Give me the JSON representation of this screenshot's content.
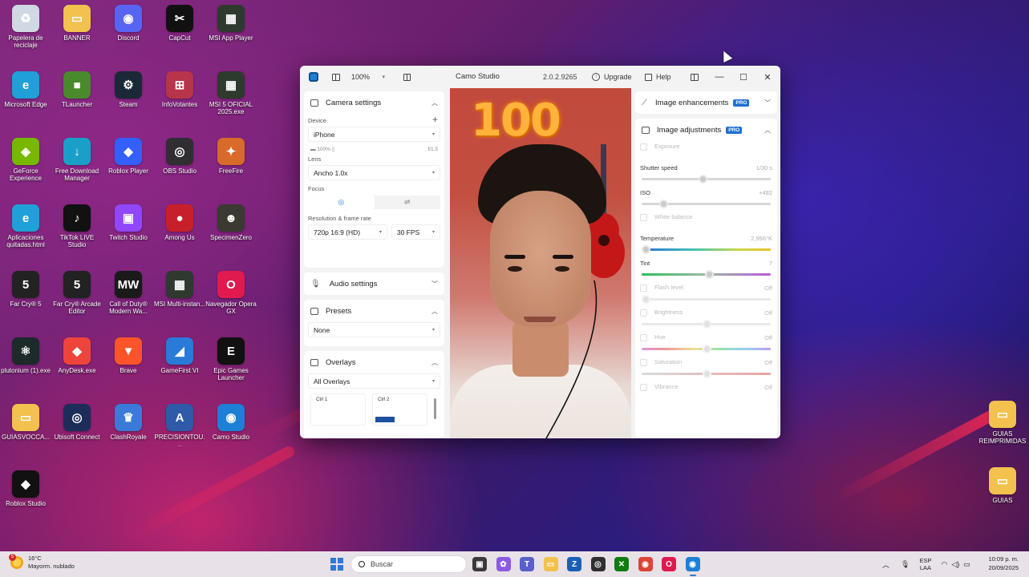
{
  "desktop": {
    "icons": [
      {
        "label": "Papelera de reciclaje",
        "icon": "recycle-bin-icon",
        "color": "#cfd8e3",
        "glyph": "♻"
      },
      {
        "label": "BANNER",
        "icon": "folder-icon",
        "color": "#f2c14e",
        "glyph": "▭"
      },
      {
        "label": "Discord",
        "icon": "discord-icon",
        "color": "#5865f2",
        "glyph": "◉"
      },
      {
        "label": "CapCut",
        "icon": "capcut-icon",
        "color": "#111111",
        "glyph": "✂"
      },
      {
        "label": "MSI App Player",
        "icon": "msi-app-player-icon",
        "color": "#2e3a2e",
        "glyph": "▦"
      },
      {
        "label": "Microsoft Edge",
        "icon": "edge-icon",
        "color": "#1fa0d8",
        "glyph": "e"
      },
      {
        "label": "TLauncher",
        "icon": "tlauncher-icon",
        "color": "#4b8a2c",
        "glyph": "■"
      },
      {
        "label": "Steam",
        "icon": "steam-icon",
        "color": "#1b2838",
        "glyph": "⚙"
      },
      {
        "label": "InfoVotantes",
        "icon": "infovotantes-icon",
        "color": "#b8344a",
        "glyph": "⊞"
      },
      {
        "label": "MSI 5 OFICIAL 2025.exe",
        "icon": "msi-exe-icon",
        "color": "#2e3a2e",
        "glyph": "▦"
      },
      {
        "label": "GeForce Experience",
        "icon": "geforce-icon",
        "color": "#76b900",
        "glyph": "◈"
      },
      {
        "label": "Free Download Manager",
        "icon": "fdm-icon",
        "color": "#1aa0c8",
        "glyph": "↓"
      },
      {
        "label": "Roblox Player",
        "icon": "roblox-player-icon",
        "color": "#335fff",
        "glyph": "◆"
      },
      {
        "label": "OBS Studio",
        "icon": "obs-icon",
        "color": "#302e31",
        "glyph": "◎"
      },
      {
        "label": "FreeFire",
        "icon": "freefire-icon",
        "color": "#d86a2a",
        "glyph": "✦"
      },
      {
        "label": "Aplicaciones quitadas.html",
        "icon": "edge-html-icon",
        "color": "#1fa0d8",
        "glyph": "e"
      },
      {
        "label": "TikTok LIVE Studio",
        "icon": "tiktok-icon",
        "color": "#111111",
        "glyph": "♪"
      },
      {
        "label": "Twitch Studio",
        "icon": "twitch-icon",
        "color": "#9146ff",
        "glyph": "▣"
      },
      {
        "label": "Among Us",
        "icon": "among-us-icon",
        "color": "#c8202a",
        "glyph": "●"
      },
      {
        "label": "SpecimenZero",
        "icon": "specimenzero-icon",
        "color": "#3a3a30",
        "glyph": "☻"
      },
      {
        "label": "Far Cry® 5",
        "icon": "farcry5-icon",
        "color": "#222222",
        "glyph": "5"
      },
      {
        "label": "Far Cry® Arcade Editor",
        "icon": "farcry-arcade-icon",
        "color": "#222222",
        "glyph": "5"
      },
      {
        "label": "Call of Duty® Modern Wa...",
        "icon": "cod-icon",
        "color": "#1a1a1a",
        "glyph": "MW"
      },
      {
        "label": "MSI Multi-instan...",
        "icon": "msi-multi-icon",
        "color": "#2e3a2e",
        "glyph": "▦"
      },
      {
        "label": "Navegador Opera GX",
        "icon": "opera-gx-icon",
        "color": "#e01a4f",
        "glyph": "O"
      },
      {
        "label": "plutonium (1).exe",
        "icon": "plutonium-icon",
        "color": "#1c2a2a",
        "glyph": "⚛"
      },
      {
        "label": "AnyDesk.exe",
        "icon": "anydesk-icon",
        "color": "#ef443b",
        "glyph": "◆"
      },
      {
        "label": "Brave",
        "icon": "brave-icon",
        "color": "#fb542b",
        "glyph": "▼"
      },
      {
        "label": "GameFirst VI",
        "icon": "gamefirst-icon",
        "color": "#2a7ad8",
        "glyph": "◢"
      },
      {
        "label": "Epic Games Launcher",
        "icon": "epic-icon",
        "color": "#111111",
        "glyph": "E"
      },
      {
        "label": "GUIASVOCCA...",
        "icon": "folder-icon",
        "color": "#f2c14e",
        "glyph": "▭"
      },
      {
        "label": "Ubisoft Connect",
        "icon": "ubisoft-icon",
        "color": "#1c2d5a",
        "glyph": "◎"
      },
      {
        "label": "ClashRoyale",
        "icon": "clash-royale-icon",
        "color": "#3a7ad8",
        "glyph": "♛"
      },
      {
        "label": "PRECISIONTOU...",
        "icon": "asus-icon",
        "color": "#2e5aa8",
        "glyph": "A"
      },
      {
        "label": "Camo Studio",
        "icon": "camo-icon",
        "color": "#1d7fd6",
        "glyph": "◉"
      },
      {
        "label": "Roblox Studio",
        "icon": "roblox-studio-icon",
        "color": "#111111",
        "glyph": "◆"
      }
    ],
    "right_icons": [
      {
        "label": "GUIAS REIMPRIMIDAS",
        "icon": "folder-icon",
        "color": "#f2c14e",
        "glyph": "▭"
      },
      {
        "label": "GUIAS",
        "icon": "folder-icon",
        "color": "#f2c14e",
        "glyph": "▭"
      }
    ]
  },
  "window": {
    "zoom": "100%",
    "title": "Camo Studio",
    "version": "2.0.2.9265",
    "upgrade_label": "Upgrade",
    "help_label": "Help",
    "minimize": "—",
    "maximize": "☐",
    "close": "✕"
  },
  "left": {
    "camera_settings": {
      "title": "Camera settings",
      "device_label": "Device",
      "device_value": "iPhone",
      "battery": "100%",
      "aperture": "f/1.5",
      "lens_label": "Lens",
      "lens_value": "Ancho 1.0x",
      "focus_label": "Focus",
      "resolution_label": "Resolution & frame rate",
      "resolution_value": "720p 16:9 (HD)",
      "fps_value": "30 FPS"
    },
    "audio_settings": {
      "title": "Audio settings"
    },
    "presets": {
      "title": "Presets",
      "value": "None"
    },
    "overlays": {
      "title": "Overlays",
      "value": "All Overlays",
      "slot1": "Ctrl 1",
      "slot2": "Ctrl 2"
    }
  },
  "video": {
    "balloon_text": "100"
  },
  "right": {
    "enhancements": {
      "title": "Image enhancements",
      "badge": "PRO"
    },
    "adjustments": {
      "title": "Image adjustments",
      "badge": "PRO"
    },
    "controls": [
      {
        "label": "Exposure",
        "value": "",
        "checkbox": true,
        "dim": true,
        "slider": null
      },
      {
        "label": "Shutter speed",
        "value": "1/30 s",
        "checkbox": false,
        "dim": false,
        "slider": {
          "type": "plain",
          "level": 0.47
        }
      },
      {
        "label": "ISO",
        "value": "+482",
        "checkbox": false,
        "dim": false,
        "slider": {
          "type": "plain",
          "level": 0.17
        }
      },
      {
        "label": "White balance",
        "value": "",
        "checkbox": true,
        "dim": true,
        "slider": null
      },
      {
        "label": "Temperature",
        "value": "2,956°K",
        "checkbox": false,
        "dim": false,
        "slider": {
          "type": "temp",
          "level": 0.03
        }
      },
      {
        "label": "Tint",
        "value": "7",
        "checkbox": false,
        "dim": false,
        "slider": {
          "type": "tint",
          "level": 0.52
        }
      },
      {
        "label": "Flash level",
        "value": "Off",
        "checkbox": true,
        "dim": true,
        "slider": {
          "type": "plain",
          "level": 0.03
        }
      },
      {
        "label": "Brightness",
        "value": "Off",
        "checkbox": true,
        "dim": true,
        "slider": {
          "type": "plain",
          "level": 0.5
        }
      },
      {
        "label": "Hue",
        "value": "Off",
        "checkbox": true,
        "dim": true,
        "slider": {
          "type": "hue",
          "level": 0.5
        }
      },
      {
        "label": "Saturation",
        "value": "Off",
        "checkbox": true,
        "dim": true,
        "slider": {
          "type": "sat",
          "level": 0.5
        }
      },
      {
        "label": "Vibrance",
        "value": "Off",
        "checkbox": true,
        "dim": true,
        "slider": null
      }
    ]
  },
  "taskbar": {
    "weather_temp": "16°C",
    "weather_desc": "Mayorm. nublado",
    "weather_badge": "5",
    "search_placeholder": "Buscar",
    "lang": "ESP",
    "lang2": "LAA",
    "time": "10:09 p. m.",
    "date": "20/09/2025",
    "apps": [
      {
        "name": "task-view-icon",
        "color": "#3a3a3a",
        "glyph": "▣"
      },
      {
        "name": "copilot-icon",
        "color": "#8a5ae0",
        "glyph": "✿"
      },
      {
        "name": "teams-icon",
        "color": "#5b5fc7",
        "glyph": "T"
      },
      {
        "name": "file-explorer-icon",
        "color": "#f2c14e",
        "glyph": "▭"
      },
      {
        "name": "photoshop-icon",
        "color": "#1a5fb4",
        "glyph": "Z"
      },
      {
        "name": "obs-taskbar-icon",
        "color": "#302e31",
        "glyph": "◎"
      },
      {
        "name": "xbox-icon",
        "color": "#107c10",
        "glyph": "✕"
      },
      {
        "name": "chrome-icon",
        "color": "#db4437",
        "glyph": "◉"
      },
      {
        "name": "opera-taskbar-icon",
        "color": "#e01a4f",
        "glyph": "O"
      },
      {
        "name": "camo-taskbar-icon",
        "color": "#1d7fd6",
        "glyph": "◉"
      }
    ]
  }
}
